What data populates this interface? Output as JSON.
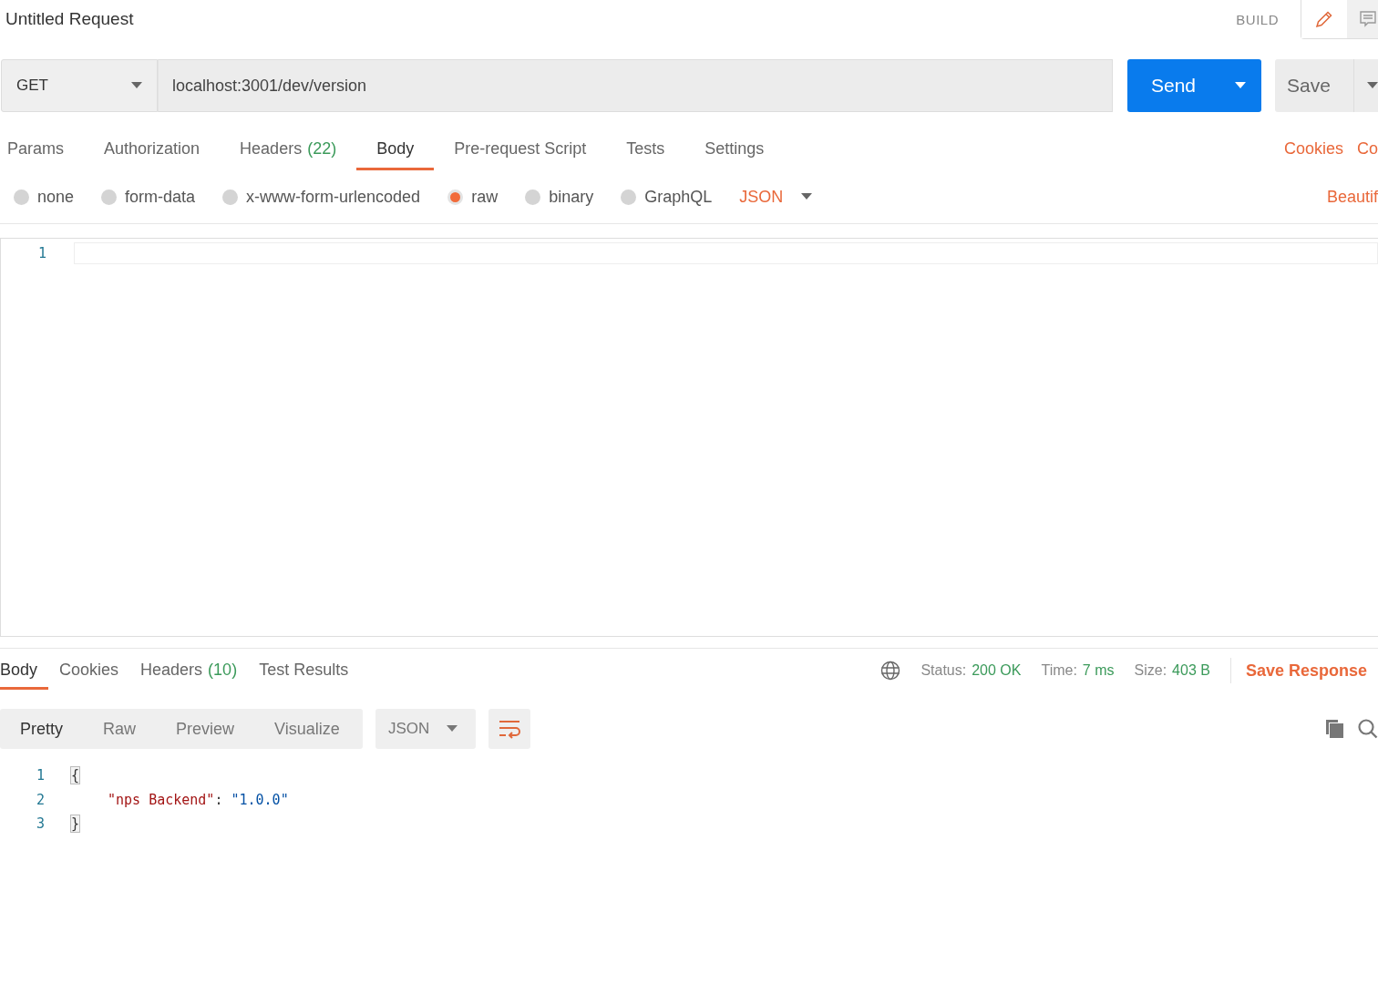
{
  "title": "Untitled Request",
  "mode_label": "BUILD",
  "request": {
    "method": "GET",
    "url": "localhost:3001/dev/version",
    "send_label": "Send",
    "save_label": "Save"
  },
  "request_tabs": [
    {
      "label": "Params",
      "selected": false
    },
    {
      "label": "Authorization",
      "selected": false
    },
    {
      "label": "Headers",
      "count": "(22)",
      "selected": false
    },
    {
      "label": "Body",
      "selected": true
    },
    {
      "label": "Pre-request Script",
      "selected": false
    },
    {
      "label": "Tests",
      "selected": false
    },
    {
      "label": "Settings",
      "selected": false
    }
  ],
  "request_links": [
    "Cookies",
    "Co"
  ],
  "body_types": [
    {
      "label": "none",
      "selected": false
    },
    {
      "label": "form-data",
      "selected": false
    },
    {
      "label": "x-www-form-urlencoded",
      "selected": false
    },
    {
      "label": "raw",
      "selected": true
    },
    {
      "label": "binary",
      "selected": false
    },
    {
      "label": "GraphQL",
      "selected": false
    }
  ],
  "body_format": "JSON",
  "beautify_label": "Beautif",
  "editor_lines": [
    "1"
  ],
  "response_tabs": [
    {
      "label": "Body",
      "selected": true
    },
    {
      "label": "Cookies",
      "selected": false
    },
    {
      "label": "Headers",
      "count": "(10)",
      "selected": false
    },
    {
      "label": "Test Results",
      "selected": false
    }
  ],
  "response_stats": [
    {
      "label": "Status:",
      "value": "200 OK"
    },
    {
      "label": "Time:",
      "value": "7 ms"
    },
    {
      "label": "Size:",
      "value": "403 B"
    }
  ],
  "save_response_label": "Save Response",
  "view_modes": [
    {
      "label": "Pretty",
      "selected": true
    },
    {
      "label": "Raw",
      "selected": false
    },
    {
      "label": "Preview",
      "selected": false
    },
    {
      "label": "Visualize",
      "selected": false
    }
  ],
  "response_format": "JSON",
  "response_lines": [
    {
      "number": "1",
      "tokens": [
        {
          "kind": "brace",
          "text": "{"
        }
      ]
    },
    {
      "number": "2",
      "tokens": [
        {
          "kind": "key",
          "text": "\"nps Backend\""
        },
        {
          "kind": "punct",
          "text": ": "
        },
        {
          "kind": "string",
          "text": "\"1.0.0\""
        }
      ]
    },
    {
      "number": "3",
      "tokens": [
        {
          "kind": "brace",
          "text": "}"
        }
      ]
    }
  ]
}
